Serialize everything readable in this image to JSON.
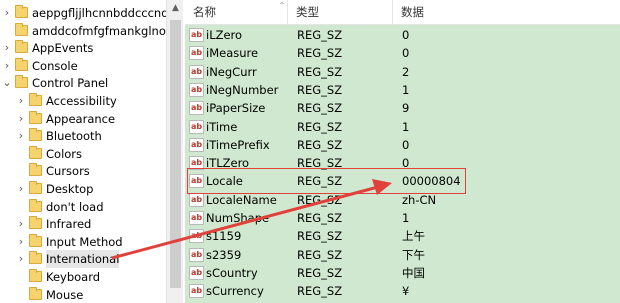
{
  "tree": {
    "items": [
      {
        "label": "aeppgfljjlhcnnbddcccndljoc",
        "level": 1,
        "expandable": true
      },
      {
        "label": "amddcofmfgfmankglnohhg",
        "level": 1,
        "expandable": false
      },
      {
        "label": "AppEvents",
        "level": 1,
        "expandable": true
      },
      {
        "label": "Console",
        "level": 1,
        "expandable": true
      },
      {
        "label": "Control Panel",
        "level": 1,
        "expandable": true,
        "expanded": true
      },
      {
        "label": "Accessibility",
        "level": 2,
        "expandable": true
      },
      {
        "label": "Appearance",
        "level": 2,
        "expandable": true
      },
      {
        "label": "Bluetooth",
        "level": 2,
        "expandable": true
      },
      {
        "label": "Colors",
        "level": 2,
        "expandable": false
      },
      {
        "label": "Cursors",
        "level": 2,
        "expandable": false
      },
      {
        "label": "Desktop",
        "level": 2,
        "expandable": true
      },
      {
        "label": "don't load",
        "level": 2,
        "expandable": false
      },
      {
        "label": "Infrared",
        "level": 2,
        "expandable": true
      },
      {
        "label": "Input Method",
        "level": 2,
        "expandable": true
      },
      {
        "label": "International",
        "level": 2,
        "expandable": true,
        "selected": true
      },
      {
        "label": "Keyboard",
        "level": 2,
        "expandable": false
      },
      {
        "label": "Mouse",
        "level": 2,
        "expandable": false
      }
    ]
  },
  "list": {
    "headers": {
      "name": "名称",
      "type": "类型",
      "data": "数据"
    },
    "rows": [
      {
        "name": "iLZero",
        "type": "REG_SZ",
        "data": "0"
      },
      {
        "name": "iMeasure",
        "type": "REG_SZ",
        "data": "0"
      },
      {
        "name": "iNegCurr",
        "type": "REG_SZ",
        "data": "2"
      },
      {
        "name": "iNegNumber",
        "type": "REG_SZ",
        "data": "1"
      },
      {
        "name": "iPaperSize",
        "type": "REG_SZ",
        "data": "9"
      },
      {
        "name": "iTime",
        "type": "REG_SZ",
        "data": "1"
      },
      {
        "name": "iTimePrefix",
        "type": "REG_SZ",
        "data": "0"
      },
      {
        "name": "iTLZero",
        "type": "REG_SZ",
        "data": "0"
      },
      {
        "name": "Locale",
        "type": "REG_SZ",
        "data": "00000804",
        "highlighted": true
      },
      {
        "name": "LocaleName",
        "type": "REG_SZ",
        "data": "zh-CN"
      },
      {
        "name": "NumShape",
        "type": "REG_SZ",
        "data": "1"
      },
      {
        "name": "s1159",
        "type": "REG_SZ",
        "data": "上午"
      },
      {
        "name": "s2359",
        "type": "REG_SZ",
        "data": "下午"
      },
      {
        "name": "sCountry",
        "type": "REG_SZ",
        "data": "中国"
      },
      {
        "name": "sCurrency",
        "type": "REG_SZ",
        "data": "¥"
      }
    ],
    "string_value_icon": "ab"
  },
  "colors": {
    "list_background": "#cfe8cf",
    "highlight": "#e0413b",
    "folder": "#f6d36c"
  },
  "icons": {
    "tree_expander": "chevron-right-icon",
    "tree_expanded": "chevron-down-icon",
    "folder": "folder-icon",
    "string_value": "reg-sz-icon"
  }
}
